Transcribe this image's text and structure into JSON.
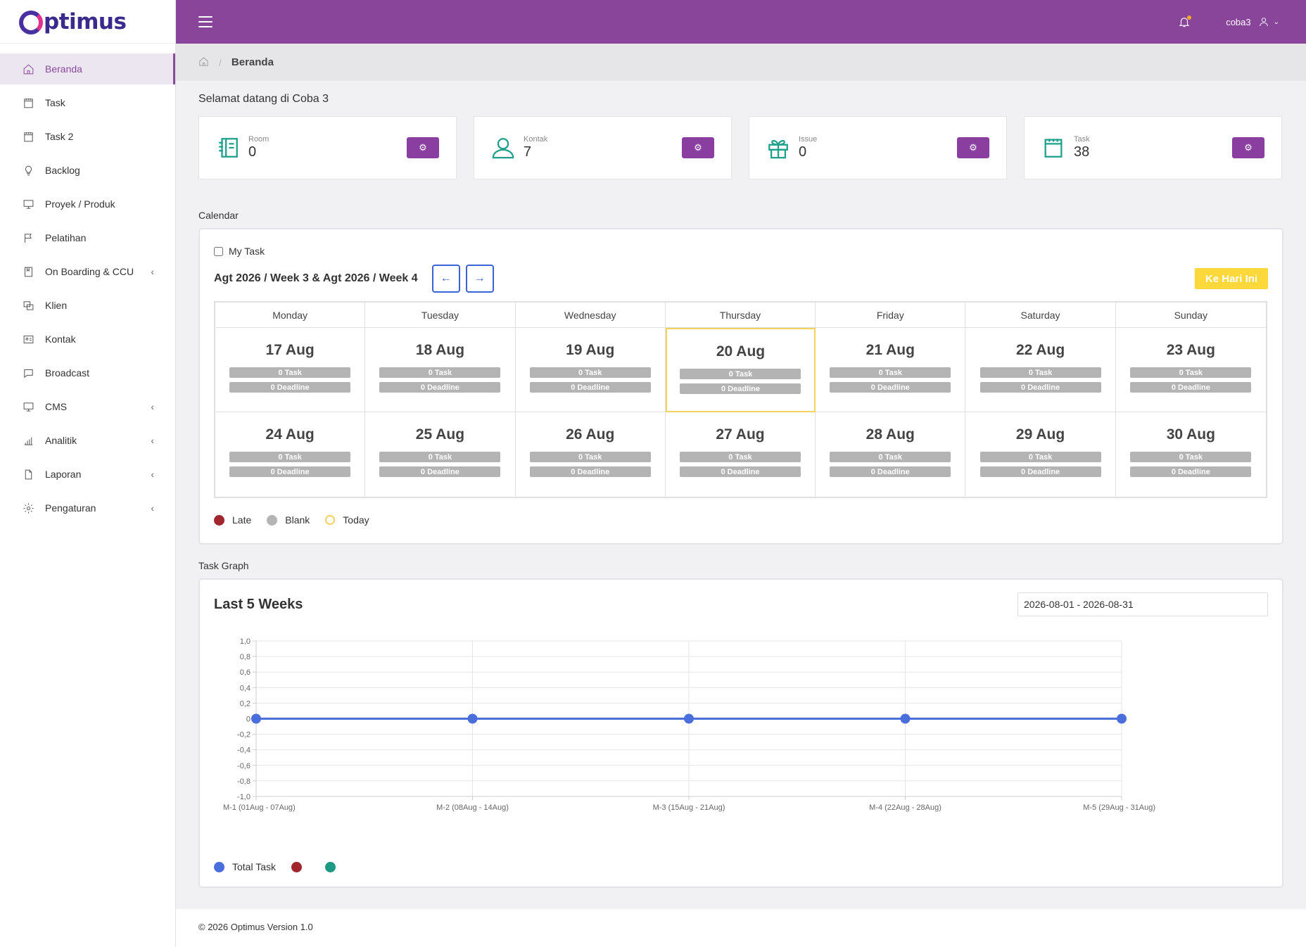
{
  "brand": {
    "name": "ptimus"
  },
  "sidebar": {
    "items": [
      {
        "label": "Beranda",
        "icon": "home-icon",
        "active": true,
        "has_caret": false
      },
      {
        "label": "Task",
        "icon": "calendar-icon",
        "has_caret": false
      },
      {
        "label": "Task 2",
        "icon": "calendar-icon",
        "has_caret": false
      },
      {
        "label": "Backlog",
        "icon": "bulb-icon",
        "has_caret": false
      },
      {
        "label": "Proyek / Produk",
        "icon": "monitor-icon",
        "has_caret": false
      },
      {
        "label": "Pelatihan",
        "icon": "flag-icon",
        "has_caret": false
      },
      {
        "label": "On Boarding & CCU",
        "icon": "book-icon",
        "has_caret": true
      },
      {
        "label": "Klien",
        "icon": "windows-icon",
        "has_caret": false
      },
      {
        "label": "Kontak",
        "icon": "id-card-icon",
        "has_caret": false
      },
      {
        "label": "Broadcast",
        "icon": "chat-icon",
        "has_caret": false
      },
      {
        "label": "CMS",
        "icon": "monitor-icon",
        "has_caret": true
      },
      {
        "label": "Analitik",
        "icon": "bar-chart-icon",
        "has_caret": true
      },
      {
        "label": "Laporan",
        "icon": "file-icon",
        "has_caret": true
      },
      {
        "label": "Pengaturan",
        "icon": "gear-icon",
        "has_caret": true
      }
    ]
  },
  "topbar": {
    "username": "coba3"
  },
  "breadcrumb": {
    "current": "Beranda"
  },
  "welcome": "Selamat datang di Coba 3",
  "stats": [
    {
      "label": "Room",
      "value": "0",
      "icon": "notebook-icon"
    },
    {
      "label": "Kontak",
      "value": "7",
      "icon": "user-icon"
    },
    {
      "label": "Issue",
      "value": "0",
      "icon": "gift-icon"
    },
    {
      "label": "Task",
      "value": "38",
      "icon": "calendar-icon"
    }
  ],
  "calendar": {
    "section_title": "Calendar",
    "my_task_label": "My Task",
    "week_label": "Agt 2026 / Week 3 & Agt 2026 / Week 4",
    "prev_label": "←",
    "next_label": "→",
    "today_button": "Ke Hari Ini",
    "days": [
      "Monday",
      "Tuesday",
      "Wednesday",
      "Thursday",
      "Friday",
      "Saturday",
      "Sunday"
    ],
    "weeks": [
      [
        {
          "date": "17 Aug",
          "task": "0 Task",
          "deadline": "0 Deadline"
        },
        {
          "date": "18 Aug",
          "task": "0 Task",
          "deadline": "0 Deadline"
        },
        {
          "date": "19 Aug",
          "task": "0 Task",
          "deadline": "0 Deadline"
        },
        {
          "date": "20 Aug",
          "task": "0 Task",
          "deadline": "0 Deadline",
          "today": true
        },
        {
          "date": "21 Aug",
          "task": "0 Task",
          "deadline": "0 Deadline"
        },
        {
          "date": "22 Aug",
          "task": "0 Task",
          "deadline": "0 Deadline"
        },
        {
          "date": "23 Aug",
          "task": "0 Task",
          "deadline": "0 Deadline"
        }
      ],
      [
        {
          "date": "24 Aug",
          "task": "0 Task",
          "deadline": "0 Deadline"
        },
        {
          "date": "25 Aug",
          "task": "0 Task",
          "deadline": "0 Deadline"
        },
        {
          "date": "26 Aug",
          "task": "0 Task",
          "deadline": "0 Deadline"
        },
        {
          "date": "27 Aug",
          "task": "0 Task",
          "deadline": "0 Deadline"
        },
        {
          "date": "28 Aug",
          "task": "0 Task",
          "deadline": "0 Deadline"
        },
        {
          "date": "29 Aug",
          "task": "0 Task",
          "deadline": "0 Deadline"
        },
        {
          "date": "30 Aug",
          "task": "0 Task",
          "deadline": "0 Deadline"
        }
      ]
    ],
    "legend": [
      {
        "label": "Late",
        "color": "#a2262e",
        "style": "filled"
      },
      {
        "label": "Blank",
        "color": "#b4b4b4",
        "style": "filled"
      },
      {
        "label": "Today",
        "color": "#f4d35e",
        "style": "ring"
      }
    ]
  },
  "graph": {
    "section_title": "Task Graph",
    "title": "Last 5 Weeks",
    "date_range": "2026-08-01 - 2026-08-31",
    "legend": [
      {
        "label": "Total Task",
        "color": "#4a6fdc"
      },
      {
        "label": "",
        "color": "#a2262e"
      },
      {
        "label": "",
        "color": "#1f9a82"
      }
    ]
  },
  "chart_data": {
    "type": "line",
    "title": "Last 5 Weeks",
    "categories": [
      "M-1 (01Aug - 07Aug)",
      "M-2 (08Aug - 14Aug)",
      "M-3 (15Aug - 21Aug)",
      "M-4 (22Aug - 28Aug)",
      "M-5 (29Aug - 31Aug)"
    ],
    "series": [
      {
        "name": "Total Task",
        "values": [
          0,
          0,
          0,
          0,
          0
        ],
        "color": "#4a6fdc"
      }
    ],
    "ylim": [
      -1.0,
      1.0
    ],
    "yticks": [
      "1,0",
      "0,8",
      "0,6",
      "0,4",
      "0,2",
      "0",
      "-0,2",
      "-0,4",
      "-0,6",
      "-0,8",
      "-1,0"
    ],
    "grid": true,
    "legend_position": "bottom-left"
  },
  "footer": "© 2026 Optimus Version 1.0"
}
